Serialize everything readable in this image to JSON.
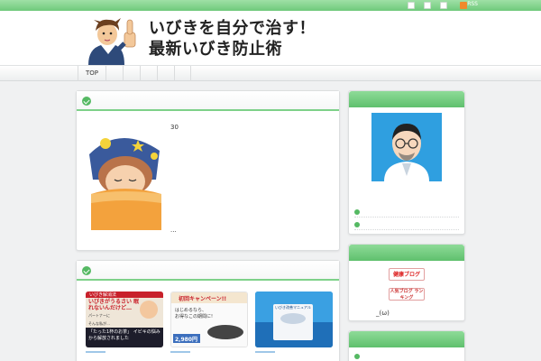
{
  "topbar": {
    "icons": [
      "user-icon",
      "page-icon",
      "mail-icon",
      "rss-icon"
    ],
    "rss_label": "RSS"
  },
  "header": {
    "title_line1": "いびきを自分で治す！",
    "title_line2": "最新いびき防止術"
  },
  "nav": {
    "items": [
      "TOP",
      "",
      "",
      "",
      "",
      ""
    ]
  },
  "main_panel": {
    "number_text": "30",
    "ellipsis": "..."
  },
  "sidebar_badges": {
    "health_blog": "健康ブログ",
    "ranking_blog": "人気ブログ ランキング",
    "emoticon": "_(ω)"
  },
  "thumbnails": [
    {
      "top_label": "いびき解消法",
      "headline": "いびきがうるさい 眠れないんだけど…",
      "sub1": "パートナーに",
      "sub2": "そんな私が…",
      "bottom": "「たった1杯のお茶」 イビキの悩みから解放されました"
    },
    {
      "headline": "初回キャンペーン!!",
      "sub1": "はじめるなら、",
      "sub2": "お得なこの期間に!",
      "price": "2,980円"
    },
    {
      "top_label": "いびき改善マニュアル"
    }
  ],
  "colors": {
    "accent_green": "#55b963",
    "header_green": "#6fc97b",
    "divider_green": "#7ed189"
  }
}
